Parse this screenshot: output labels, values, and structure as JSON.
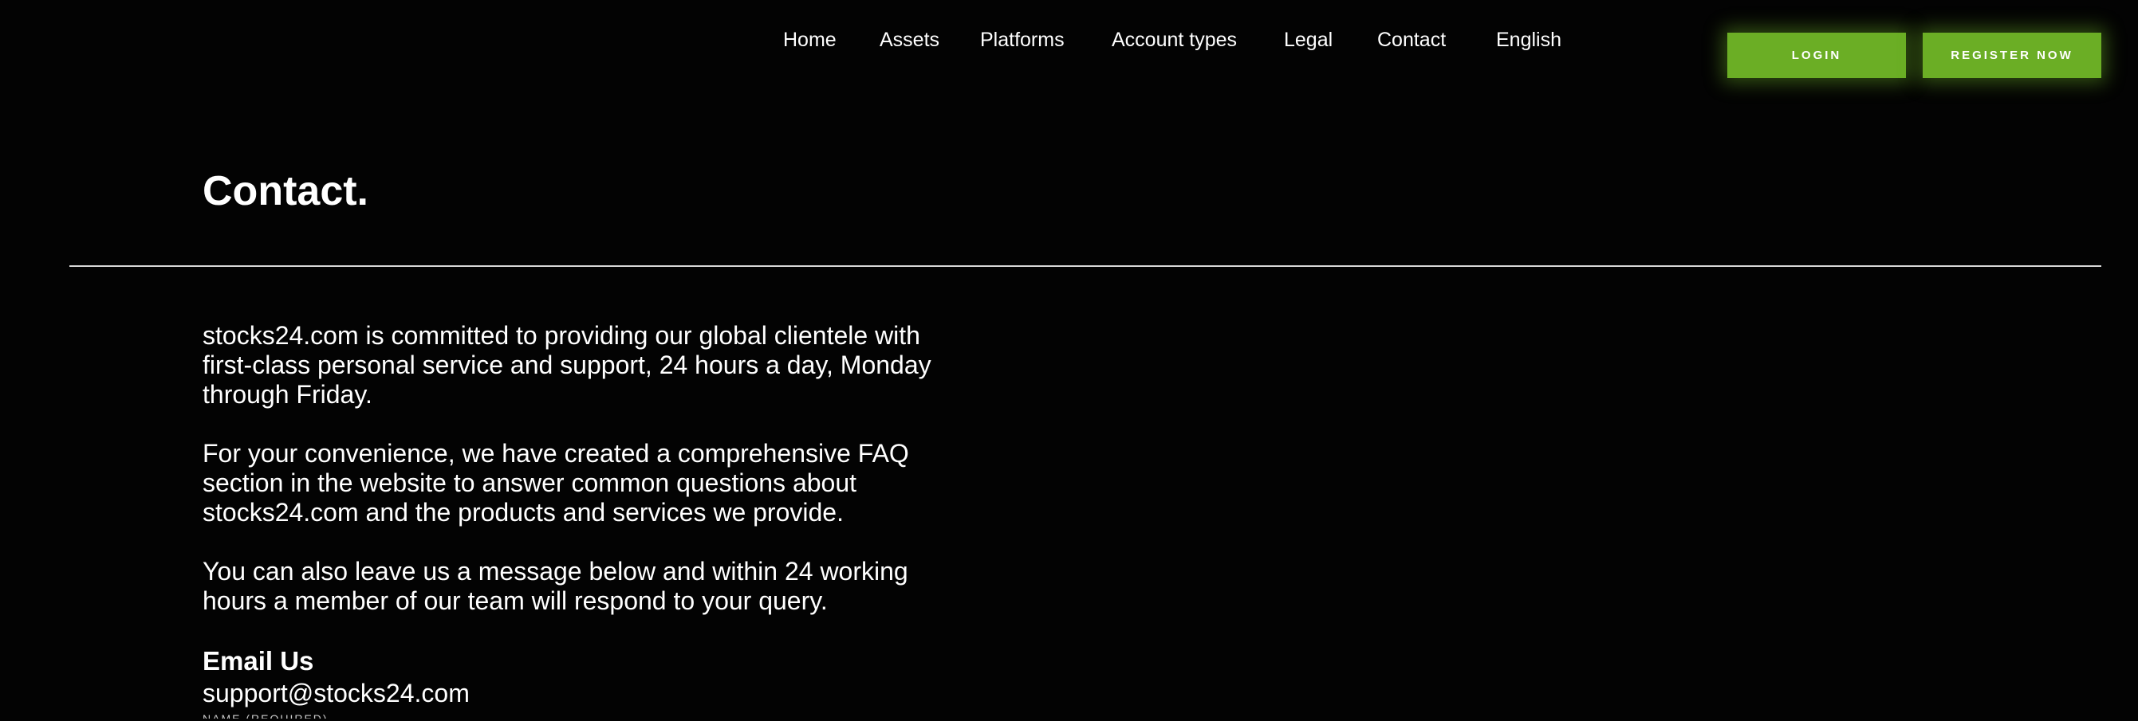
{
  "nav": {
    "items": [
      {
        "label": "Home"
      },
      {
        "label": "Assets"
      },
      {
        "label": "Platforms"
      },
      {
        "label": "Account types"
      },
      {
        "label": "Legal"
      },
      {
        "label": "Contact"
      },
      {
        "label": "English"
      }
    ],
    "login_label": "LOGIN",
    "register_label": "REGISTER NOW"
  },
  "main": {
    "title": "Contact.",
    "paragraphs": [
      "stocks24.com is committed to providing our global clientele with first-class personal service and support, 24 hours a day, Monday through Friday.",
      "For your convenience, we have created a comprehensive FAQ section in the website to answer common questions about stocks24.com and the products and services we provide.",
      "You can also leave us a message below and within 24 working hours a member of our team will respond to your query."
    ],
    "email_heading": "Email Us",
    "email_value": "support@stocks24.com",
    "cutoff_label": "NAME (REQUIRED)"
  },
  "colors": {
    "background": "#030303",
    "accent": "#6bae25",
    "text": "#ffffff"
  }
}
